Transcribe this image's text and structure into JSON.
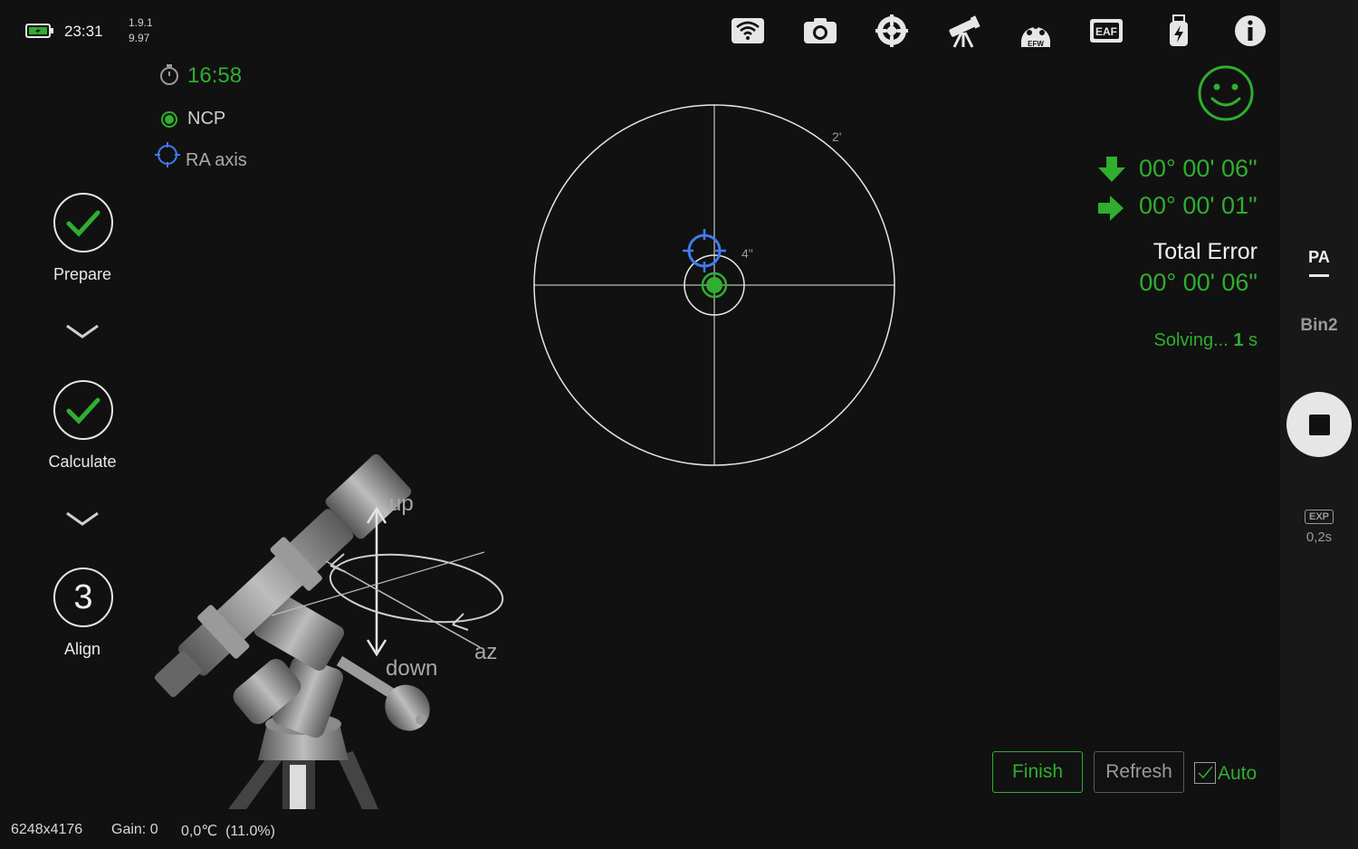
{
  "status": {
    "time": "23:31",
    "version_line1": "1.9.1",
    "version_line2": "9.97"
  },
  "toolbar": {
    "icons": [
      "wifi-icon",
      "camera-icon",
      "focus-target-icon",
      "telescope-icon",
      "efw-icon",
      "eaf-icon",
      "usb-power-icon",
      "info-icon"
    ],
    "efw_label": "EFW",
    "eaf_label": "EAF"
  },
  "info": {
    "timer": "16:58",
    "ncp_label": "NCP",
    "ra_axis_label": "RA axis"
  },
  "steps": [
    {
      "label": "Prepare",
      "state": "done"
    },
    {
      "label": "Calculate",
      "state": "done"
    },
    {
      "label": "Align",
      "state": "current",
      "number": "3"
    }
  ],
  "target": {
    "outer_label": "2'",
    "inner_label": "4\""
  },
  "errors": {
    "alt_error": "00° 00' 06\"",
    "az_error": "00° 00' 01\"",
    "total_label": "Total Error",
    "total_value": "00° 00' 06\"",
    "solving_prefix": "Solving... ",
    "solving_count": "1",
    "solving_unit": " s"
  },
  "illustration": {
    "up": "up",
    "down": "down",
    "az": "az"
  },
  "side": {
    "pa_label": "PA",
    "bin_label": "Bin2",
    "exp_label": "EXP",
    "exp_value": "0,2s"
  },
  "actions": {
    "finish": "Finish",
    "refresh": "Refresh",
    "auto": "Auto",
    "auto_checked": true
  },
  "footer": {
    "resolution": "6248x4176",
    "gain": "Gain: 0",
    "temp": "0,0℃  (11.0%)"
  },
  "colors": {
    "accent_green": "#2fae2f",
    "ra_blue": "#3f7bf0",
    "background": "#111111"
  }
}
